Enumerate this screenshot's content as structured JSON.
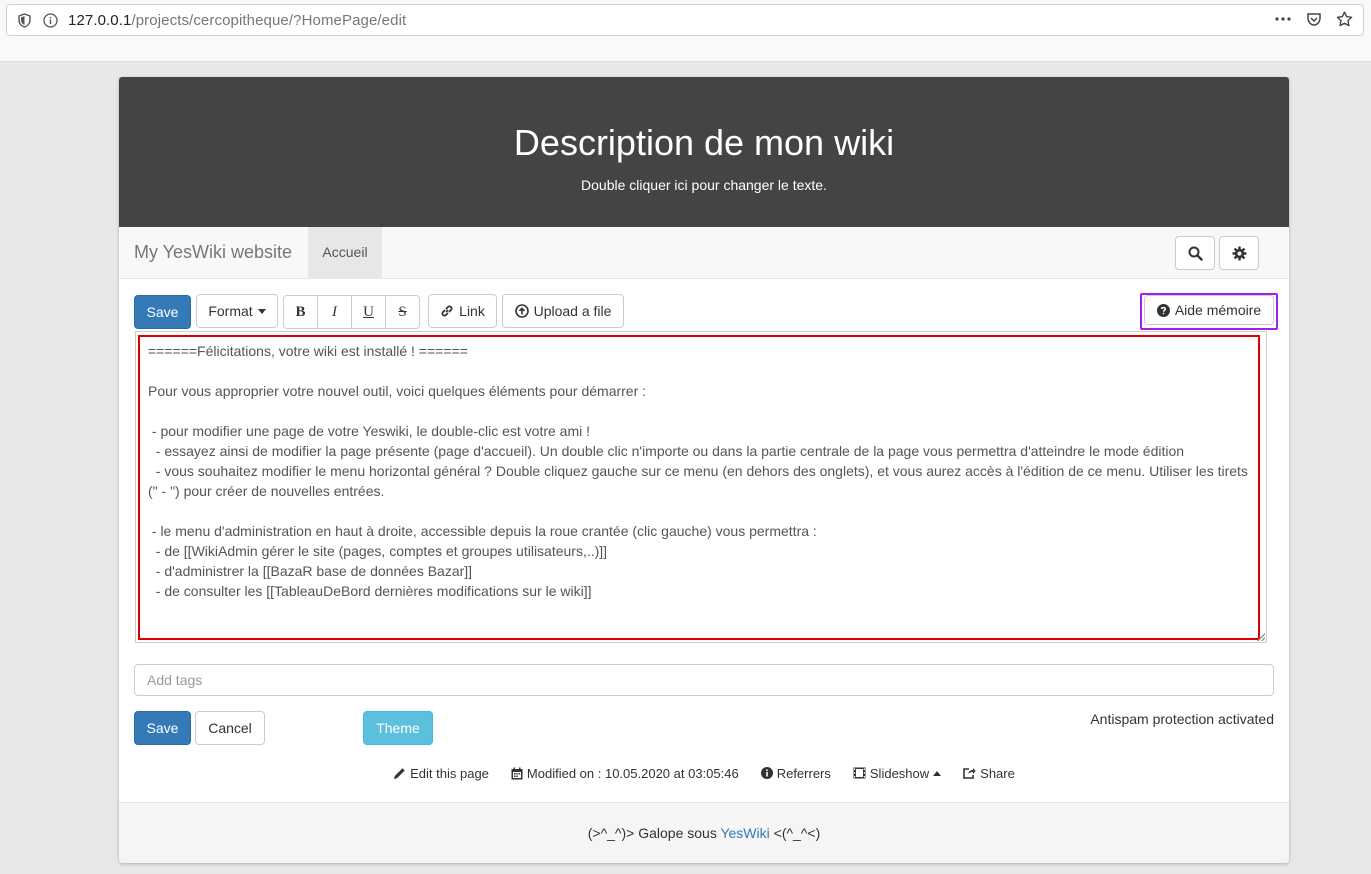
{
  "browser": {
    "url_host": "127.0.0.1",
    "url_path": "/projects/cercopitheque/?HomePage/edit"
  },
  "banner": {
    "title": "Description de mon wiki",
    "subtitle": "Double cliquer ici pour changer le texte."
  },
  "navbar": {
    "brand": "My YesWiki website",
    "tab": "Accueil"
  },
  "toolbar": {
    "save_label": "Save",
    "format_label": "Format",
    "bold": "B",
    "italic": "I",
    "underline": "U",
    "strike": "S",
    "link_label": "Link",
    "upload_label": "Upload a file",
    "aide_label": "Aide mémoire"
  },
  "editor": {
    "content": "======Félicitations, votre wiki est installé ! ======\n\nPour vous approprier votre nouvel outil, voici quelques éléments pour démarrer :\n\n - pour modifier une page de votre Yeswiki, le double-clic est votre ami !\n  - essayez ainsi de modifier la page présente (page d'accueil). Un double clic n'importe ou dans la partie centrale de la page vous permettra d'atteindre le mode édition\n  - vous souhaitez modifier le menu horizontal général ? Double cliquez gauche sur ce menu (en dehors des onglets), et vous aurez accès à l'édition de ce menu. Utiliser les tirets (\" - \") pour créer de nouvelles entrées.\n\n - le menu d'administration en haut à droite, accessible depuis la roue crantée (clic gauche) vous permettra :\n  - de [[WikiAdmin gérer le site (pages, comptes et groupes utilisateurs,..)]]\n  - d'administrer la [[BazaR base de données Bazar]]\n  - de consulter les [[TableauDeBord dernières modifications sur le wiki]]"
  },
  "tags": {
    "placeholder": "Add tags"
  },
  "actions": {
    "save_label": "Save",
    "cancel_label": "Cancel",
    "theme_label": "Theme",
    "antispam": "Antispam protection activated"
  },
  "footer_links": {
    "edit": "Edit this page",
    "modified": "Modified on : 10.05.2020 at 03:05:46",
    "referrers": "Referrers",
    "slideshow": "Slideshow",
    "share": "Share"
  },
  "footer": {
    "prefix": "(>^_^)> Galope sous ",
    "link": "YesWiki",
    "suffix": " <(^_^<)"
  },
  "colors": {
    "banner_bg": "#444444",
    "primary": "#337ab7",
    "info": "#5bc0de",
    "highlight_red": "#e00000",
    "highlight_purple": "#a020f0"
  }
}
